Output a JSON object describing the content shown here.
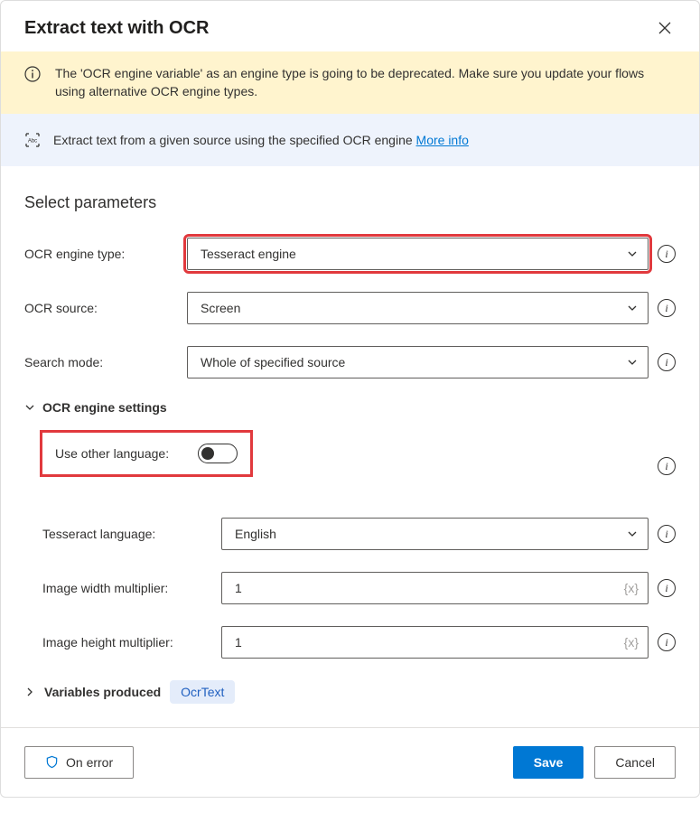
{
  "header": {
    "title": "Extract text with OCR"
  },
  "warning": {
    "text": "The 'OCR engine variable' as an engine type is going to be deprecated.  Make sure you update your flows using alternative OCR engine types."
  },
  "info": {
    "text": "Extract text from a given source using the specified OCR engine ",
    "more_info": "More info"
  },
  "params": {
    "section_title": "Select parameters",
    "engine_type_label": "OCR engine type:",
    "engine_type_value": "Tesseract engine",
    "source_label": "OCR source:",
    "source_value": "Screen",
    "search_mode_label": "Search mode:",
    "search_mode_value": "Whole of specified source"
  },
  "settings": {
    "header": "OCR engine settings",
    "use_other_lang_label": "Use other language:",
    "tesseract_lang_label": "Tesseract language:",
    "tesseract_lang_value": "English",
    "width_mult_label": "Image width multiplier:",
    "width_mult_value": "1",
    "height_mult_label": "Image height multiplier:",
    "height_mult_value": "1",
    "input_suffix": "{x}"
  },
  "vars": {
    "header": "Variables produced",
    "badge": "OcrText"
  },
  "footer": {
    "on_error": "On error",
    "save": "Save",
    "cancel": "Cancel"
  }
}
